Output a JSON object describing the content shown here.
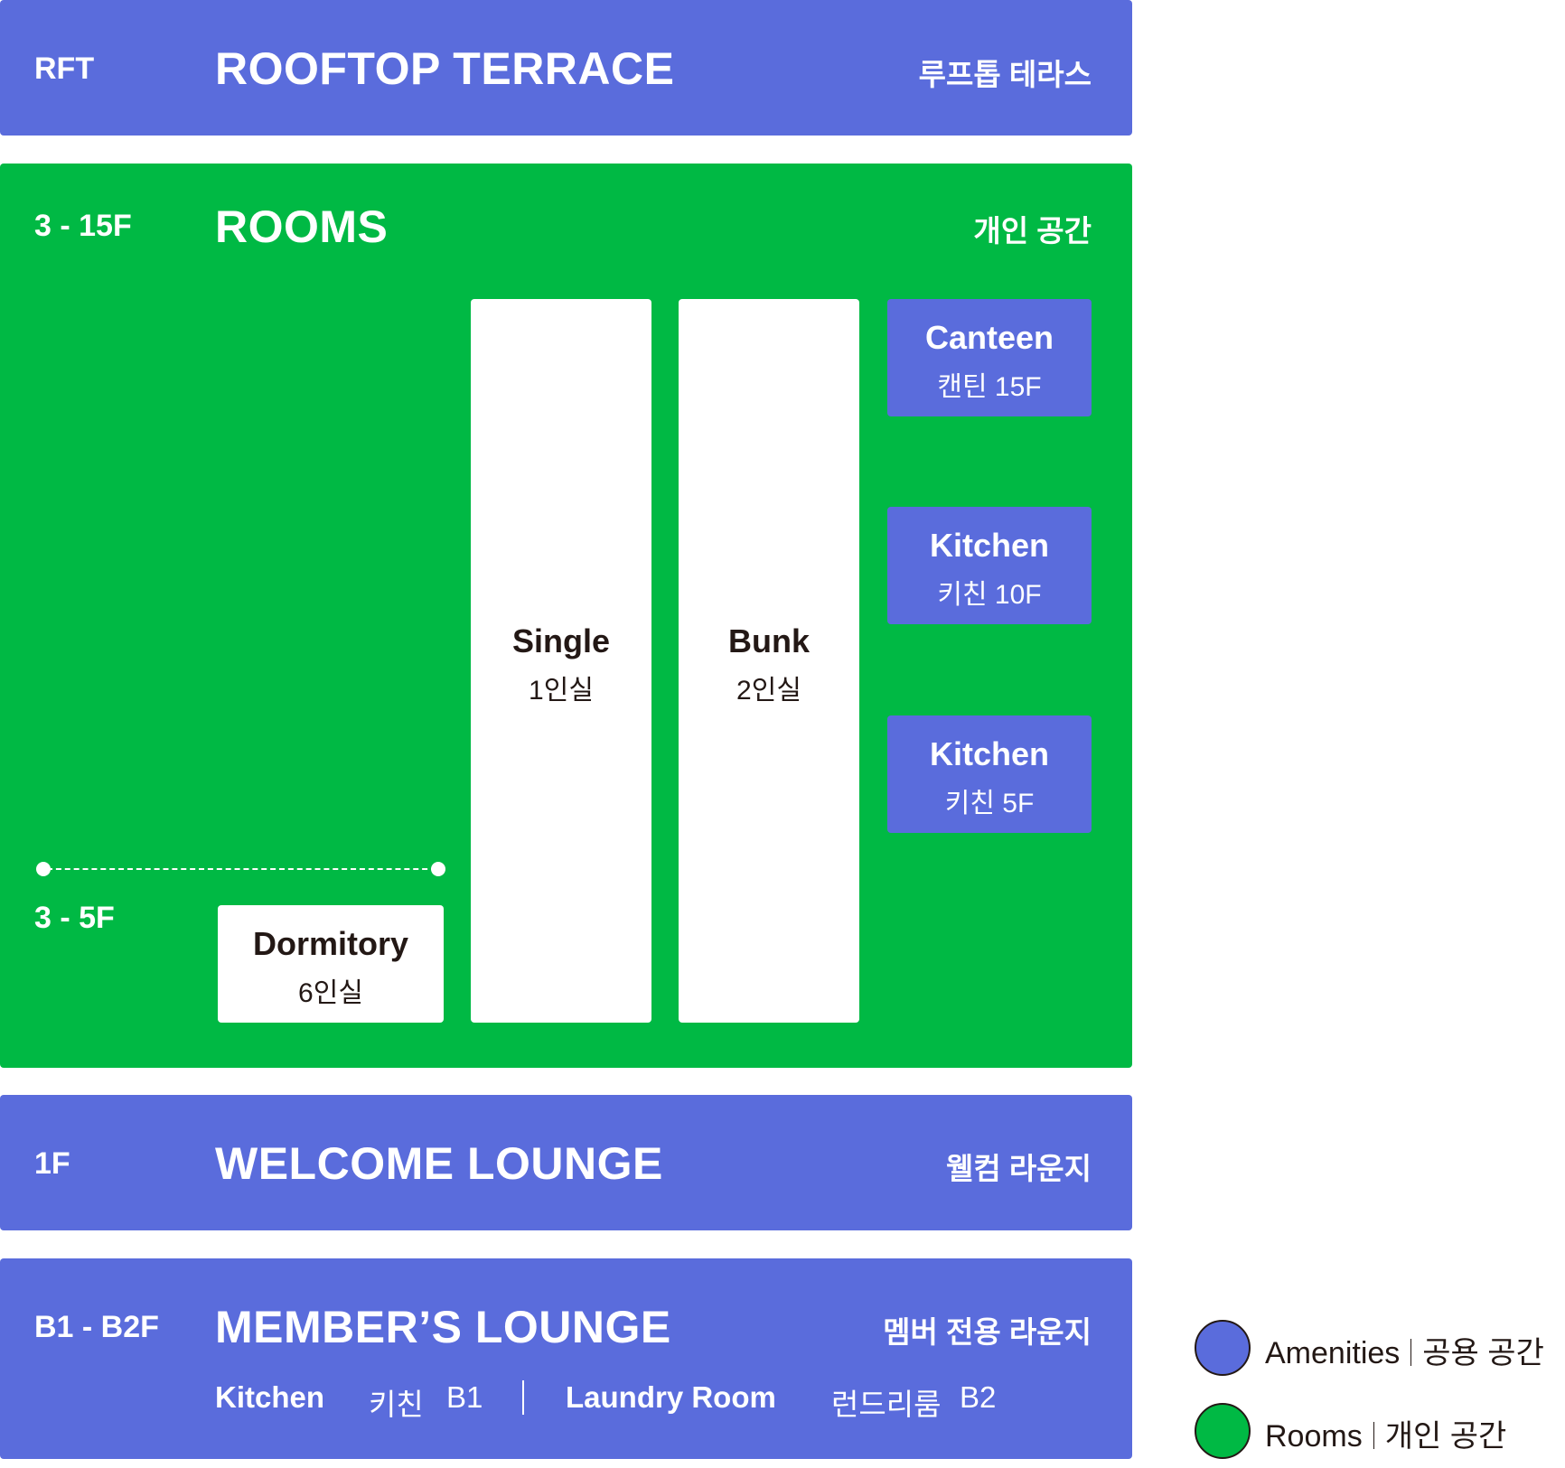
{
  "bands": {
    "rooftop": {
      "floor": "RFT",
      "title": "ROOFTOP TERRACE",
      "ko": "루프톱 테라스"
    },
    "rooms": {
      "floor": "3 - 15F",
      "title": "ROOMS",
      "ko": "개인 공간",
      "sub_floor": "3 - 5F"
    },
    "welcome": {
      "floor": "1F",
      "title": "WELCOME LOUNGE",
      "ko": "웰컴 라운지"
    },
    "member": {
      "floor": "B1 - B2F",
      "title": "MEMBER’S LOUNGE",
      "ko": "멤버 전용 라운지"
    }
  },
  "rooms": {
    "dormitory": {
      "en": "Dormitory",
      "kr": "6인실"
    },
    "single": {
      "en": "Single",
      "kr": "1인실"
    },
    "bunk": {
      "en": "Bunk",
      "kr": "2인실"
    }
  },
  "amenities": {
    "canteen": {
      "en": "Canteen",
      "kr": "캔틴 15F"
    },
    "kitchen10": {
      "en": "Kitchen",
      "kr": "키친 10F"
    },
    "kitchen5": {
      "en": "Kitchen",
      "kr": "키친 5F"
    }
  },
  "member_items": {
    "kitchen": {
      "en": "Kitchen",
      "kr": "키친",
      "floor": "B1"
    },
    "laundry": {
      "en": "Laundry Room",
      "kr": "런드리룸",
      "floor": "B2"
    }
  },
  "legend": {
    "amenities": {
      "en": "Amenities",
      "kr": "공용 공간",
      "color": "#5A6CDC"
    },
    "rooms": {
      "en": "Rooms",
      "kr": "개인 공간",
      "color": "#00B944"
    }
  }
}
